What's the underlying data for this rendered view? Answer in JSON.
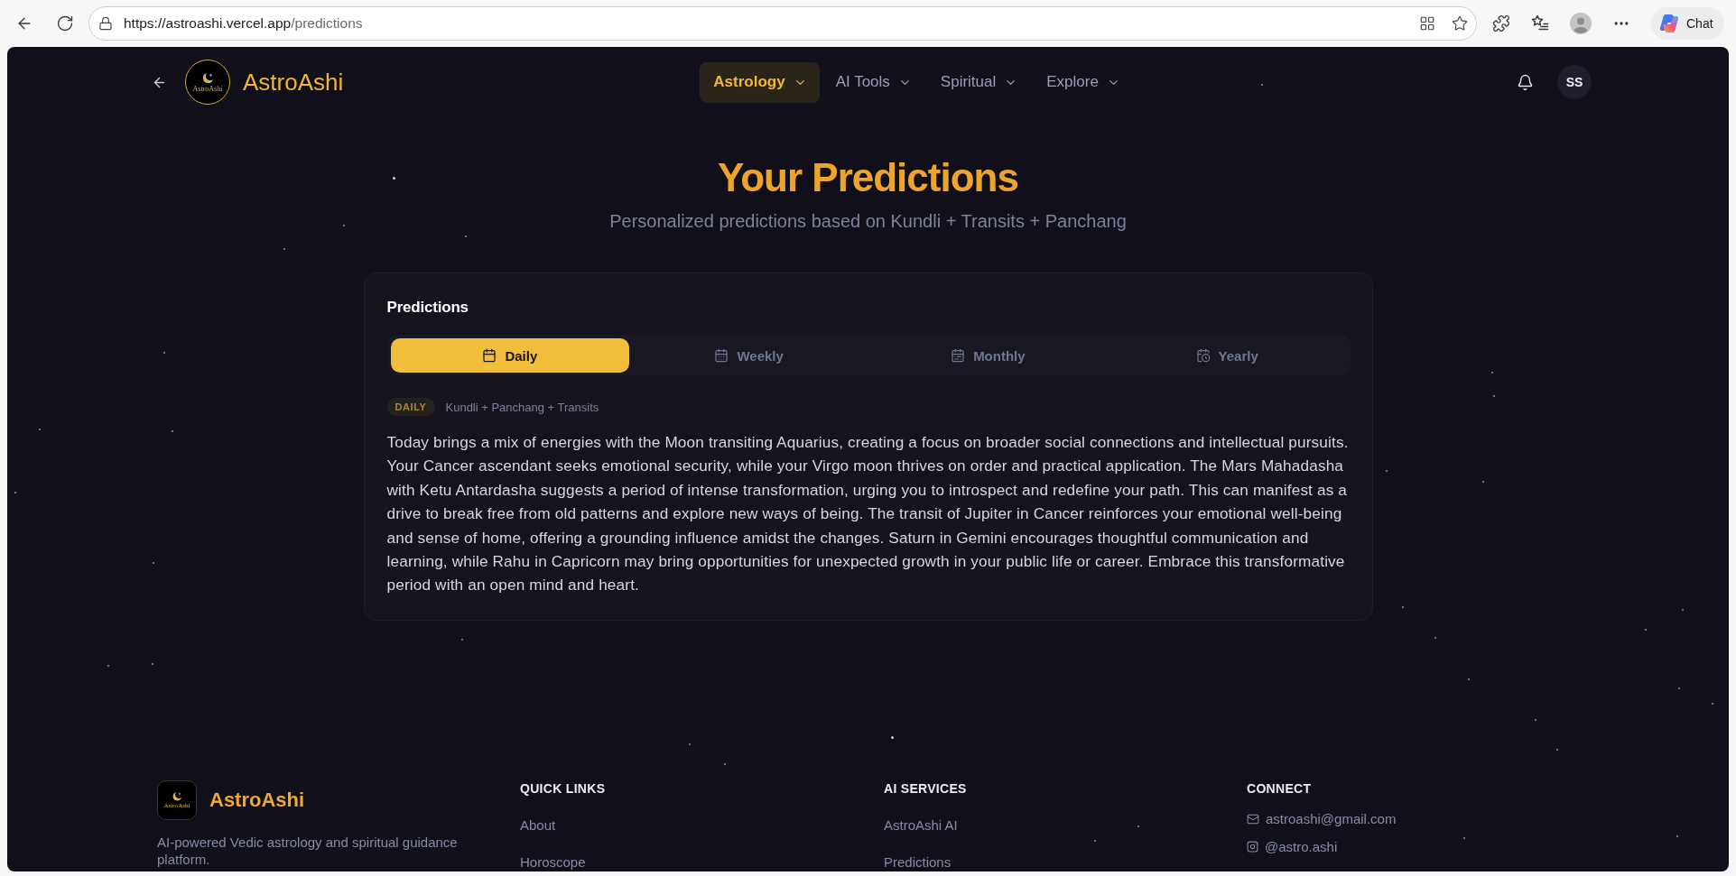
{
  "browser": {
    "url_host": "https://astroashi.vercel.app",
    "url_path": "/predictions",
    "chat_label": "Chat"
  },
  "header": {
    "logo_text": "AstroAshi",
    "brand": "AstroAshi",
    "nav": [
      {
        "label": "Astrology",
        "selected": true
      },
      {
        "label": "AI Tools",
        "selected": false
      },
      {
        "label": "Spiritual",
        "selected": false
      },
      {
        "label": "Explore",
        "selected": false
      }
    ],
    "avatar": "SS"
  },
  "hero": {
    "title": "Your Predictions",
    "subtitle": "Personalized predictions based on Kundli + Transits + Panchang"
  },
  "card": {
    "title": "Predictions",
    "tabs": [
      {
        "label": "Daily",
        "selected": true
      },
      {
        "label": "Weekly",
        "selected": false
      },
      {
        "label": "Monthly",
        "selected": false
      },
      {
        "label": "Yearly",
        "selected": false
      }
    ],
    "badge": "DAILY",
    "sources": "Kundli + Panchang + Transits",
    "text": "Today brings a mix of energies with the Moon transiting Aquarius, creating a focus on broader social connections and intellectual pursuits. Your Cancer ascendant seeks emotional security, while your Virgo moon thrives on order and practical application. The Mars Mahadasha with Ketu Antardasha suggests a period of intense transformation, urging you to introspect and redefine your path. This can manifest as a drive to break free from old patterns and explore new ways of being. The transit of Jupiter in Cancer reinforces your emotional well-being and sense of home, offering a grounding influence amidst the changes. Saturn in Gemini encourages thoughtful communication and learning, while Rahu in Capricorn may bring opportunities for unexpected growth in your public life or career. Embrace this transformative period with an open mind and heart."
  },
  "footer": {
    "logo_text": "AstroAshi",
    "brand": "AstroAshi",
    "description": "AI-powered Vedic astrology and spiritual guidance platform.",
    "columns": [
      {
        "heading": "QUICK LINKS",
        "links": [
          "About",
          "Horoscope"
        ]
      },
      {
        "heading": "AI SERVICES",
        "links": [
          "AstroAshi AI",
          "Predictions"
        ]
      }
    ],
    "connect": {
      "heading": "CONNECT",
      "items": [
        {
          "kind": "email",
          "text": "astroashi@gmail.com"
        },
        {
          "kind": "instagram",
          "text": "@astro.ashi"
        }
      ]
    }
  }
}
